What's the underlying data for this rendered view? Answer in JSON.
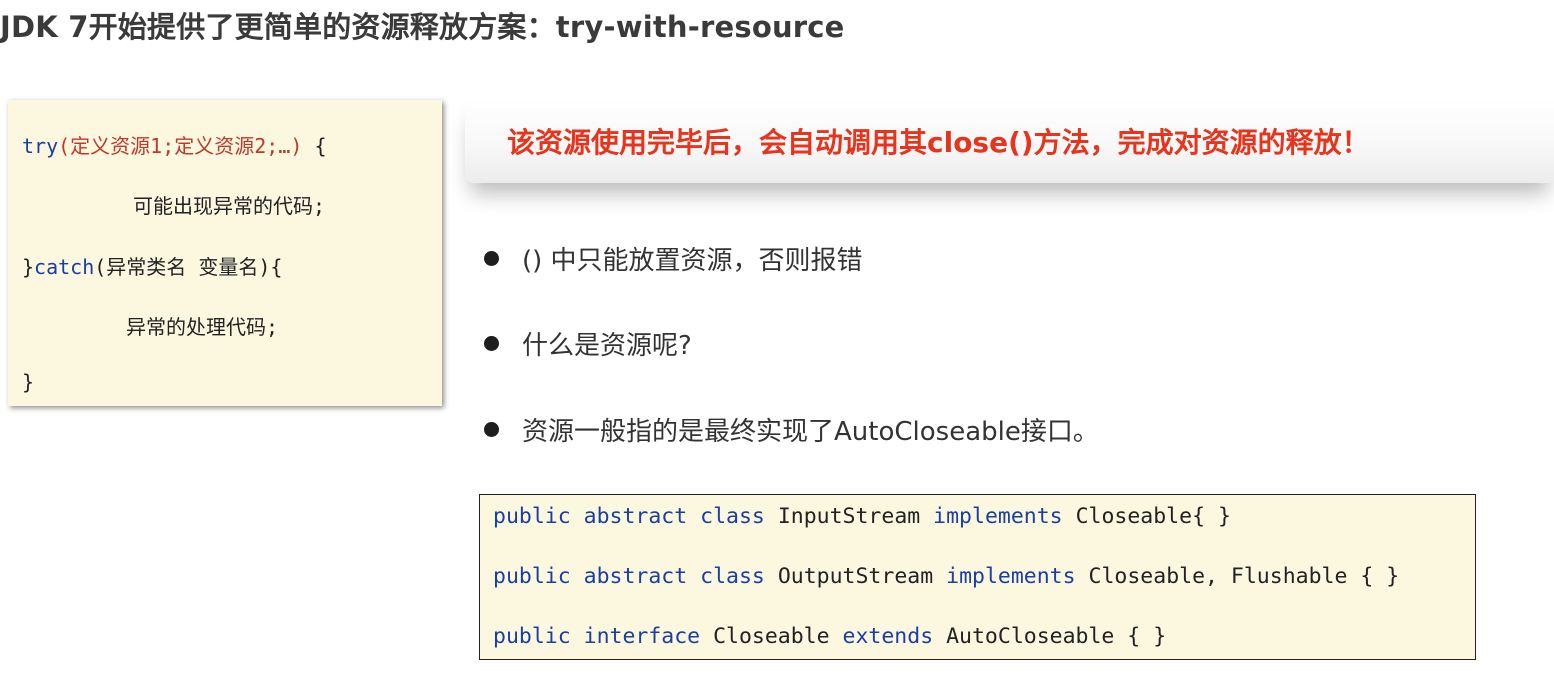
{
  "title": "JDK 7开始提供了更简单的资源释放方案：try-with-resource",
  "left_code": {
    "line1": {
      "kw": "try",
      "open": "(",
      "resources": "定义资源1;定义资源2;…",
      "close": ")",
      "brace": " {"
    },
    "line2": "可能出现异常的代码;",
    "line3": {
      "brace": "}",
      "kw": "catch",
      "rest": "(异常类名 变量名){"
    },
    "line4": "异常的处理代码;",
    "line5": "}"
  },
  "callout": {
    "text": "该资源使用完毕后，会自动调用其close()方法，完成对资源的释放！"
  },
  "bullets": [
    "() 中只能放置资源，否则报错",
    "什么是资源呢?",
    "资源一般指的是最终实现了AutoCloseable接口。"
  ],
  "right_code": {
    "line1": {
      "kw1": "public",
      "kw2": "abstract",
      "kw3": "class",
      "name": "InputStream",
      "kw4": "implements",
      "rest": "Closeable{ }"
    },
    "line2": {
      "kw1": "public",
      "kw2": "abstract",
      "kw3": "class",
      "name": "OutputStream",
      "kw4": "implements",
      "rest": "Closeable, Flushable { }"
    },
    "line3": {
      "kw1": "public",
      "kw2": "interface",
      "name": "Closeable",
      "kw3": "extends",
      "rest": "AutoCloseable { }"
    }
  },
  "colors": {
    "keyword": "#1a3ea8",
    "resource_text": "#c0392b",
    "callout_text": "#e8341c",
    "code_bg": "#fcf8df"
  }
}
